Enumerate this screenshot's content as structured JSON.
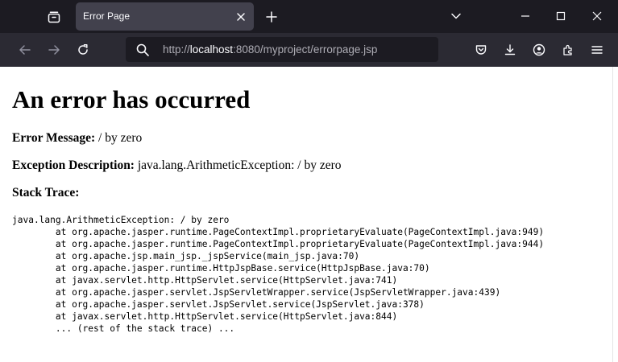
{
  "browser": {
    "tab": {
      "title": "Error Page"
    },
    "url": {
      "prefix": "http://",
      "host": "localhost",
      "rest": ":8080/myproject/errorpage.jsp"
    },
    "icons": {
      "tab_list": "tab-list-icon",
      "close_tab": "close-icon",
      "new_tab": "plus-icon",
      "list_all_tabs": "chevron-down-icon",
      "minimize": "minimize-icon",
      "maximize": "maximize-icon",
      "close_window": "close-window-icon",
      "back": "back-arrow-icon",
      "forward": "forward-arrow-icon",
      "reload": "reload-icon",
      "search": "search-icon",
      "pocket": "pocket-icon",
      "downloads": "download-icon",
      "account": "account-icon",
      "extensions": "extensions-icon",
      "menu": "hamburger-menu-icon"
    },
    "colors": {
      "tabbar": "#1c1b22",
      "navbar": "#2b2a33",
      "active_tab": "#42414d",
      "text": "#fbfbfe"
    }
  },
  "page": {
    "heading": "An error has occurred",
    "error_message": {
      "label": "Error Message:",
      "value": "/ by zero"
    },
    "exception_description": {
      "label": "Exception Description:",
      "value": "java.lang.ArithmeticException: / by zero"
    },
    "stack_trace_label": "Stack Trace:",
    "stack_trace": [
      "java.lang.ArithmeticException: / by zero",
      "        at org.apache.jasper.runtime.PageContextImpl.proprietaryEvaluate(PageContextImpl.java:949)",
      "        at org.apache.jasper.runtime.PageContextImpl.proprietaryEvaluate(PageContextImpl.java:944)",
      "        at org.apache.jsp.main_jsp._jspService(main_jsp.java:70)",
      "        at org.apache.jasper.runtime.HttpJspBase.service(HttpJspBase.java:70)",
      "        at javax.servlet.http.HttpServlet.service(HttpServlet.java:741)",
      "        at org.apache.jasper.servlet.JspServletWrapper.service(JspServletWrapper.java:439)",
      "        at org.apache.jasper.servlet.JspServlet.service(JspServlet.java:378)",
      "        at javax.servlet.http.HttpServlet.service(HttpServlet.java:844)",
      "        ... (rest of the stack trace) ..."
    ]
  }
}
